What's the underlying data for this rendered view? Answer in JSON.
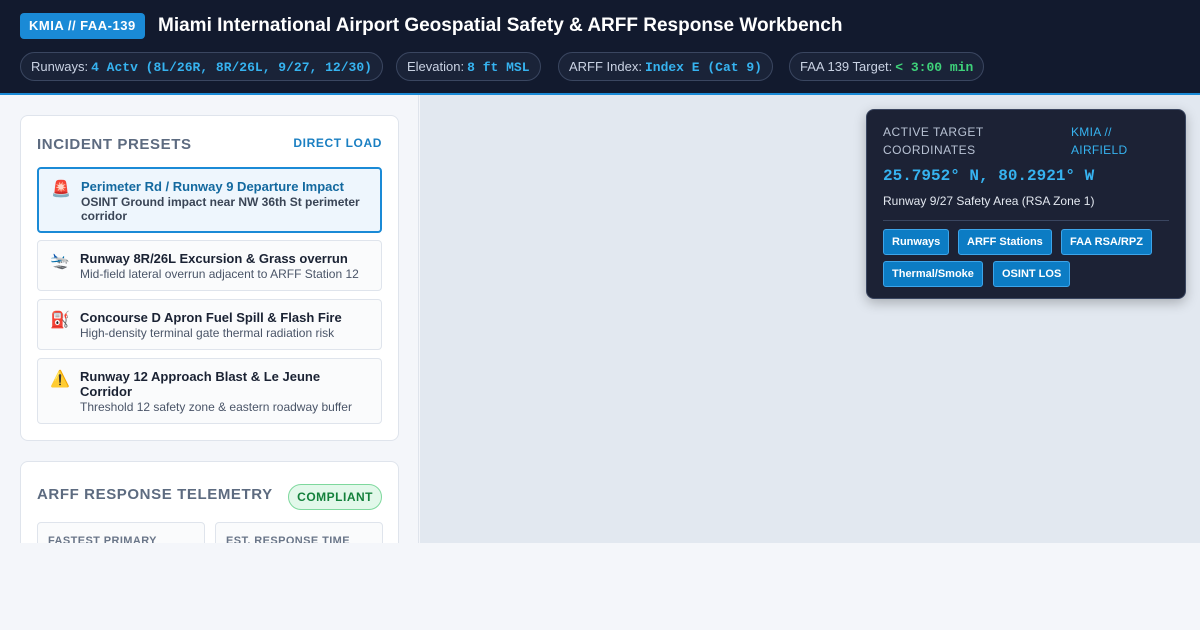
{
  "header": {
    "code": "KMIA // FAA-139",
    "title": "Miami International Airport Geospatial Safety & ARFF Response Workbench",
    "stats": [
      {
        "label": "Runways:",
        "value": "4 Actv (8L/26R, 8R/26L, 9/27, 12/30)"
      },
      {
        "label": "Elevation:",
        "value": "8 ft MSL"
      },
      {
        "label": "ARFF Index:",
        "value": "Index E (Cat 9)"
      },
      {
        "label": "FAA 139 Target:",
        "value": "< 3:00 min"
      }
    ]
  },
  "presets": {
    "title": "INCIDENT PRESETS",
    "action": "DIRECT LOAD",
    "items": [
      {
        "icon": "🚨",
        "title": "Perimeter Rd / Runway 9 Departure Impact",
        "subtitle": "OSINT Ground impact near NW 36th St perimeter corridor"
      },
      {
        "icon": "🛬",
        "title": "Runway 8R/26L Excursion & Grass overrun",
        "subtitle": "Mid-field lateral overrun adjacent to ARFF Station 12"
      },
      {
        "icon": "⛽",
        "title": "Concourse D Apron Fuel Spill & Flash Fire",
        "subtitle": "High-density terminal gate thermal radiation risk"
      },
      {
        "icon": "⚠️",
        "title": "Runway 12 Approach Blast & Le Jeune Corridor",
        "subtitle": "Threshold 12 safety zone & eastern roadway buffer"
      }
    ]
  },
  "telemetry": {
    "title": "ARFF RESPONSE TELEMETRY",
    "status": "COMPLIANT",
    "boxes": [
      {
        "label": "FASTEST PRIMARY"
      },
      {
        "label": "EST. RESPONSE TIME"
      }
    ]
  },
  "target": {
    "label": "ACTIVE TARGET COORDINATES",
    "airfield": "KMIA // AIRFIELD",
    "coords": "25.7952° N, 80.2921° W",
    "zone": "Runway 9/27 Safety Area (RSA Zone 1)",
    "layers": [
      "Runways",
      "ARFF Stations",
      "FAA RSA/RPZ",
      "Thermal/Smoke",
      "OSINT LOS"
    ]
  }
}
